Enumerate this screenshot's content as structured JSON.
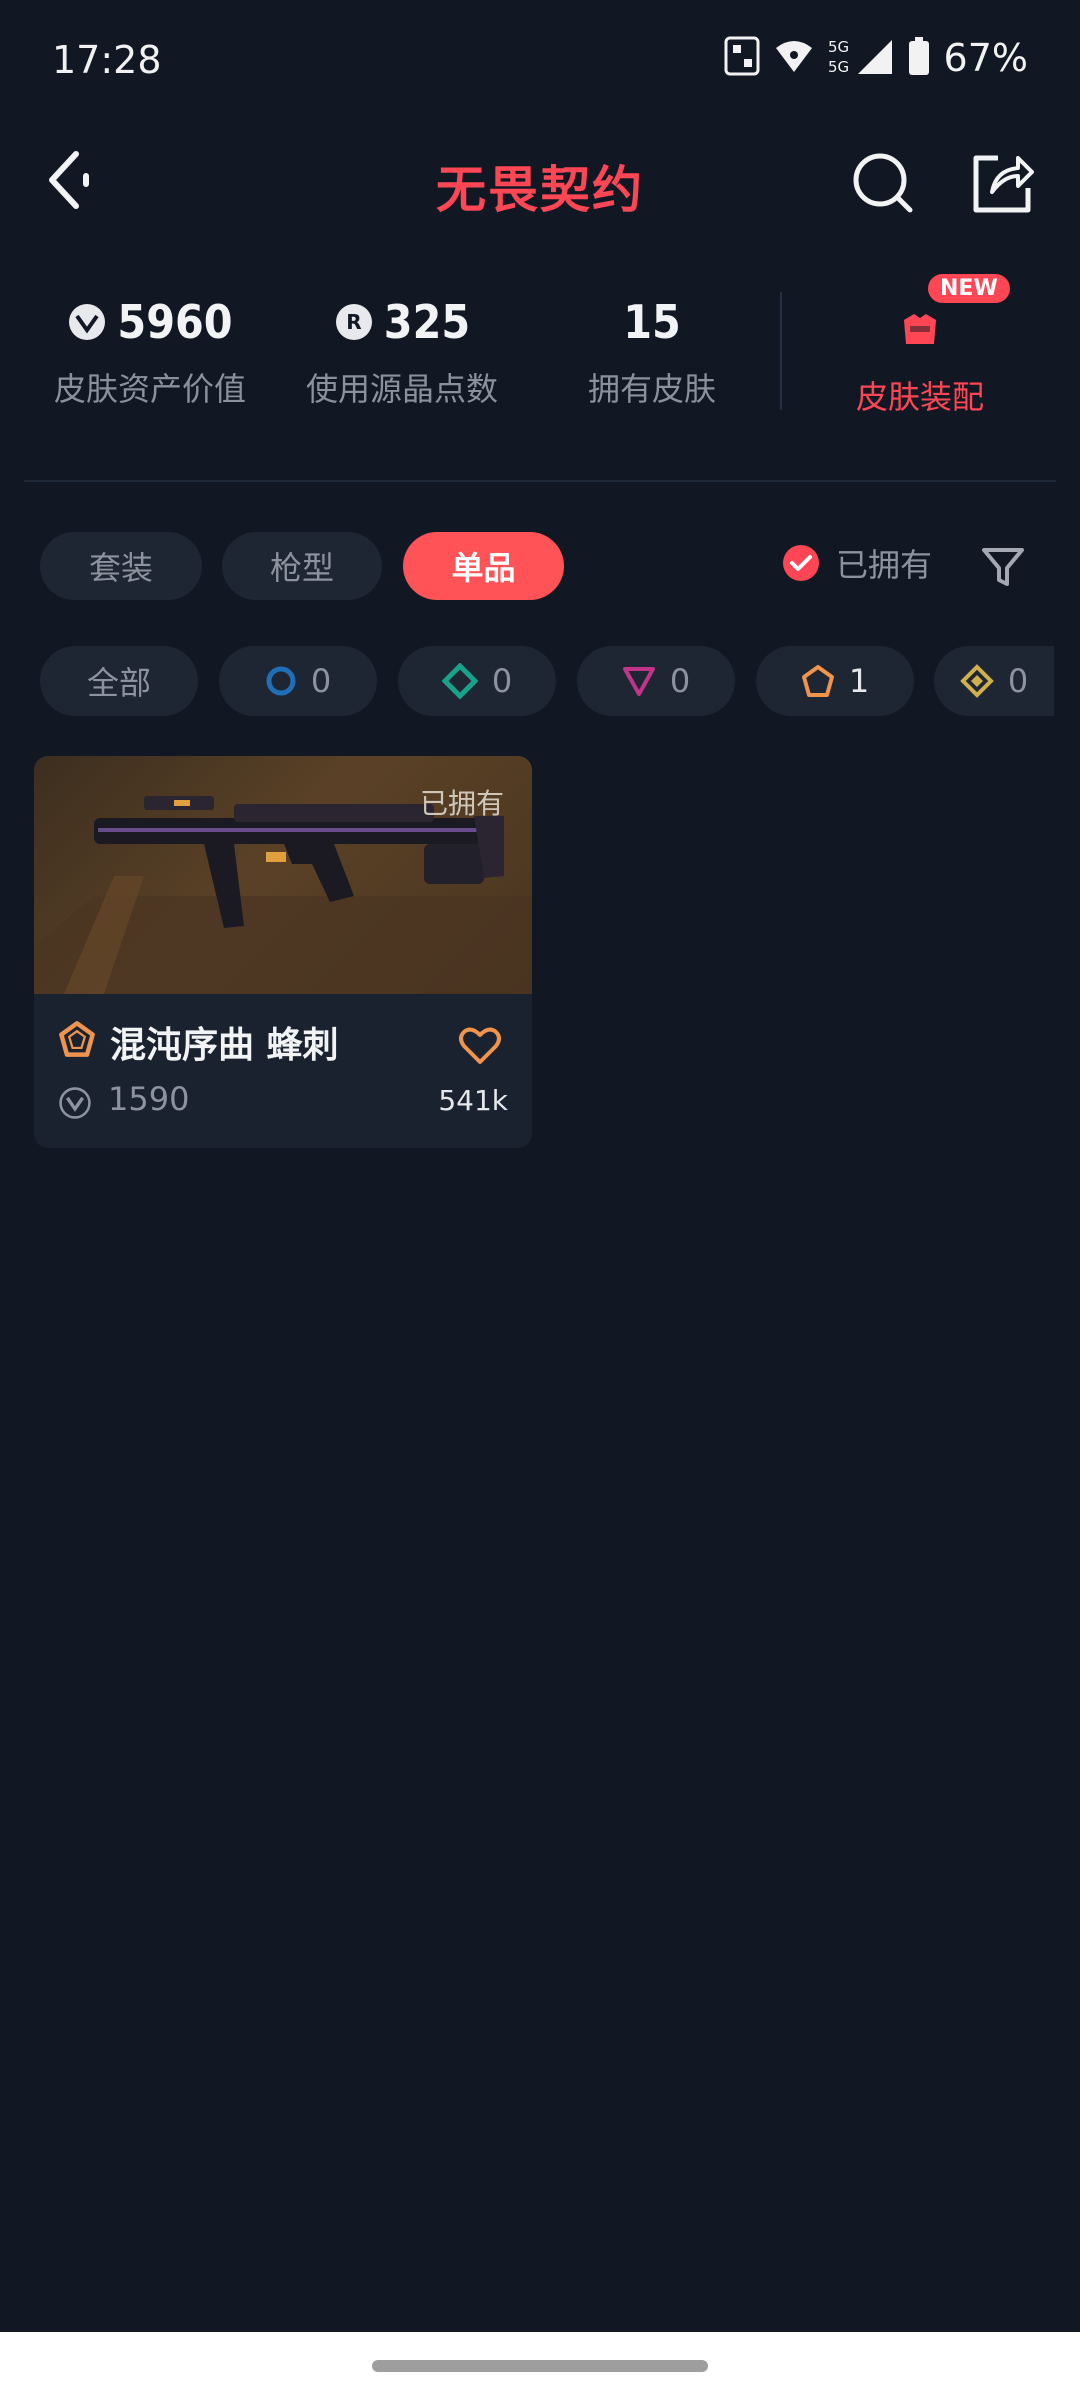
{
  "status_bar": {
    "time": "17:28",
    "battery": "67%",
    "network": "5G"
  },
  "header": {
    "title": "无畏契约"
  },
  "stats": [
    {
      "value": "5960",
      "label": "皮肤资产价值",
      "icon": "vp-icon"
    },
    {
      "value": "325",
      "label": "使用源晶点数",
      "icon": "radianite-icon"
    },
    {
      "value": "15",
      "label": "拥有皮肤",
      "icon": ""
    }
  ],
  "equip": {
    "label": "皮肤装配",
    "badge": "NEW"
  },
  "tabs": [
    {
      "label": "套装",
      "active": false
    },
    {
      "label": "枪型",
      "active": false
    },
    {
      "label": "单品",
      "active": true
    }
  ],
  "owned_filter": {
    "label": "已拥有",
    "checked": true
  },
  "rarity_chips": [
    {
      "label": "全部",
      "count": "",
      "color": ""
    },
    {
      "label": "",
      "count": "0",
      "color": "#1f6fb8"
    },
    {
      "label": "",
      "count": "0",
      "color": "#19a28a"
    },
    {
      "label": "",
      "count": "0",
      "color": "#c2338a"
    },
    {
      "label": "",
      "count": "1",
      "color": "#f0934d"
    },
    {
      "label": "",
      "count": "0",
      "color": "#d1b04c"
    }
  ],
  "items": [
    {
      "name": "混沌序曲 蜂刺",
      "owned_tag": "已拥有",
      "price": "1590",
      "likes": "541k",
      "rarity_color": "#f0934d"
    }
  ],
  "colors": {
    "accent": "#ff4655",
    "background": "#111824"
  }
}
